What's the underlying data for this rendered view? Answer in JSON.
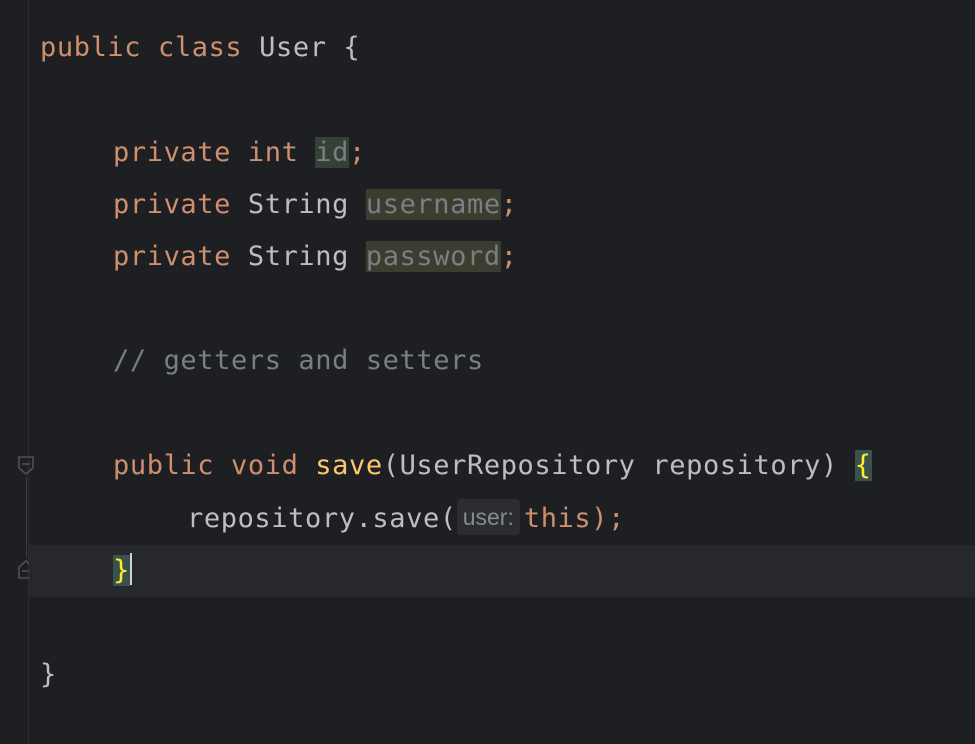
{
  "editor": {
    "lines": {
      "l1": {
        "kw_public": "public",
        "kw_class": "class",
        "name": "User",
        "brace": "{"
      },
      "l2": {
        "kw_private": "private",
        "kw_type": "int",
        "field": "id",
        "semi": ";"
      },
      "l3": {
        "kw_private": "private",
        "type": "String",
        "field": "username",
        "semi": ";"
      },
      "l4": {
        "kw_private": "private",
        "type": "String",
        "field": "password",
        "semi": ";"
      },
      "l5": {
        "comment": "// getters and setters"
      },
      "l6": {
        "kw_public": "public",
        "kw_void": "void",
        "method": "save",
        "open_paren": "(",
        "param_type": "UserRepository",
        "param_name": "repository",
        "close_paren": ")",
        "brace": "{"
      },
      "l7": {
        "receiver": "repository",
        "call": ".save(",
        "hint": "user:",
        "arg": "this",
        "close": ");"
      },
      "l8": {
        "brace": "}"
      },
      "l9": {
        "brace": "}"
      }
    },
    "colors": {
      "background": "#1e1f22",
      "keyword": "#cf8e6d",
      "method": "#ffc66d",
      "comment": "#7a7e85",
      "text": "#bcbec4",
      "brace_match": "#ffef28"
    },
    "icons": {
      "fold_open": "fold-open-icon",
      "fold_close": "fold-close-icon"
    }
  }
}
